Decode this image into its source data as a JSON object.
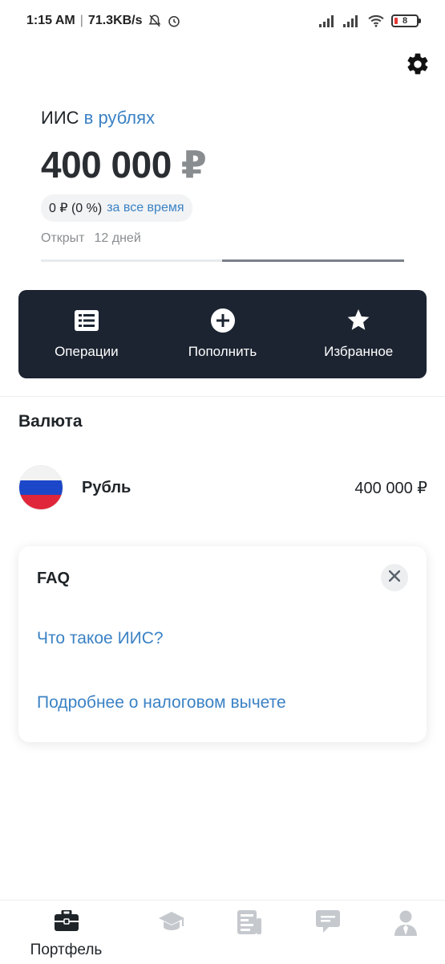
{
  "status_bar": {
    "time": "1:15 AM",
    "speed": "71.3KB/s",
    "battery": "8"
  },
  "header": {
    "account_name": "ИИС",
    "account_currency": "в рублях",
    "balance": "400 000",
    "balance_currency": "₽",
    "change_value": "0 ₽ (0 %)",
    "change_period": "за все время",
    "opened_label": "Открыт",
    "opened_value": "12 дней"
  },
  "actions": [
    {
      "label": "Операции",
      "icon": "list-icon"
    },
    {
      "label": "Пополнить",
      "icon": "plus-circle-icon"
    },
    {
      "label": "Избранное",
      "icon": "star-icon"
    }
  ],
  "currency_section": {
    "title": "Валюта",
    "items": [
      {
        "name": "Рубль",
        "amount": "400 000 ₽",
        "icon": "russia-flag-icon"
      }
    ]
  },
  "faq": {
    "title": "FAQ",
    "links": [
      "Что такое ИИС?",
      "Подробнее о налоговом вычете"
    ]
  },
  "bottom_nav": {
    "items": [
      {
        "label": "Портфель",
        "icon": "briefcase-icon",
        "active": true
      },
      {
        "label": "",
        "icon": "graduation-cap-icon",
        "active": false
      },
      {
        "label": "",
        "icon": "news-icon",
        "active": false
      },
      {
        "label": "",
        "icon": "chat-icon",
        "active": false
      },
      {
        "label": "",
        "icon": "profile-icon",
        "active": false
      }
    ]
  },
  "colors": {
    "accent": "#3b82c4",
    "action_bar_bg": "#1c2431",
    "inactive_icon": "#c5c9ce"
  }
}
